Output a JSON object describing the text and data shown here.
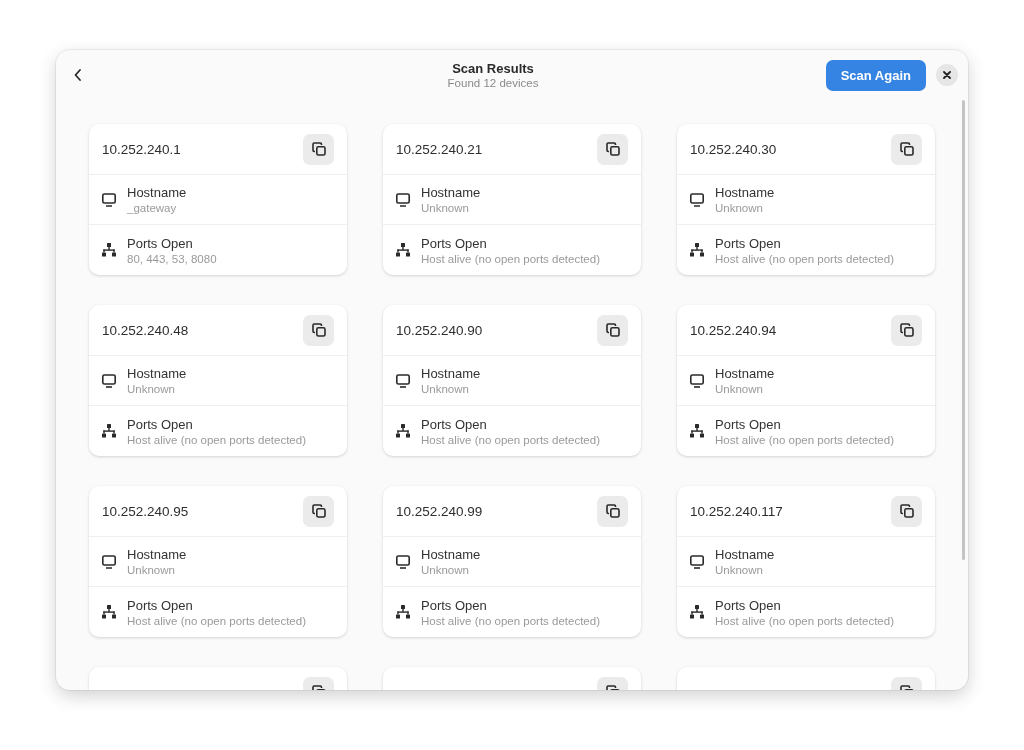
{
  "header": {
    "title": "Scan Results",
    "subtitle": "Found 12 devices",
    "action": "Scan Again"
  },
  "devices": [
    {
      "kind": "full",
      "ip": "10.252.240.1",
      "hostname_label": "Hostname",
      "hostname": "_gateway",
      "ports_label": "Ports Open",
      "ports": "80, 443, 53, 8080"
    },
    {
      "kind": "full",
      "ip": "10.252.240.21",
      "hostname_label": "Hostname",
      "hostname": "Unknown",
      "ports_label": "Ports Open",
      "ports": "Host alive (no open ports detected)"
    },
    {
      "kind": "full",
      "ip": "10.252.240.30",
      "hostname_label": "Hostname",
      "hostname": "Unknown",
      "ports_label": "Ports Open",
      "ports": "Host alive (no open ports detected)"
    },
    {
      "kind": "full",
      "ip": "10.252.240.48",
      "hostname_label": "Hostname",
      "hostname": "Unknown",
      "ports_label": "Ports Open",
      "ports": "Host alive (no open ports detected)"
    },
    {
      "kind": "full",
      "ip": "10.252.240.90",
      "hostname_label": "Hostname",
      "hostname": "Unknown",
      "ports_label": "Ports Open",
      "ports": "Host alive (no open ports detected)"
    },
    {
      "kind": "full",
      "ip": "10.252.240.94",
      "hostname_label": "Hostname",
      "hostname": "Unknown",
      "ports_label": "Ports Open",
      "ports": "Host alive (no open ports detected)"
    },
    {
      "kind": "full",
      "ip": "10.252.240.95",
      "hostname_label": "Hostname",
      "hostname": "Unknown",
      "ports_label": "Ports Open",
      "ports": "Host alive (no open ports detected)"
    },
    {
      "kind": "full",
      "ip": "10.252.240.99",
      "hostname_label": "Hostname",
      "hostname": "Unknown",
      "ports_label": "Ports Open",
      "ports": "Host alive (no open ports detected)"
    },
    {
      "kind": "full",
      "ip": "10.252.240.117",
      "hostname_label": "Hostname",
      "hostname": "Unknown",
      "ports_label": "Ports Open",
      "ports": "Host alive (no open ports detected)"
    },
    {
      "kind": "partial"
    },
    {
      "kind": "partial"
    },
    {
      "kind": "partial"
    }
  ]
}
